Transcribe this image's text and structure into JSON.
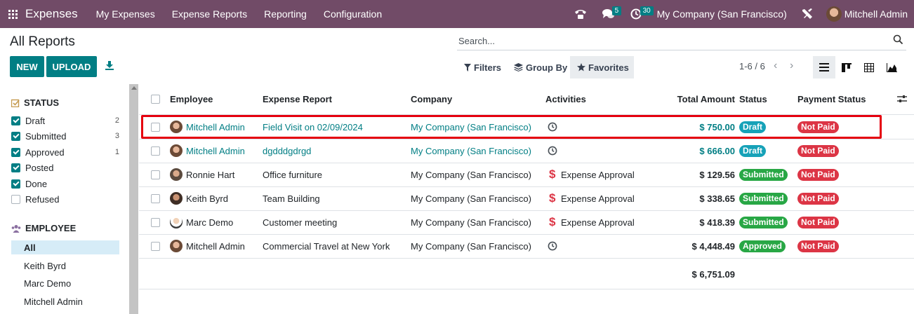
{
  "navbar": {
    "app_name": "Expenses",
    "menu": [
      "My Expenses",
      "Expense Reports",
      "Reporting",
      "Configuration"
    ],
    "messages_count": "5",
    "activities_count": "30",
    "company": "My Company (San Francisco)",
    "user": "Mitchell Admin"
  },
  "control": {
    "title": "All Reports",
    "new_label": "NEW",
    "upload_label": "UPLOAD",
    "search_placeholder": "Search...",
    "filters_label": "Filters",
    "groupby_label": "Group By",
    "favorites_label": "Favorites",
    "pager": "1-6 / 6"
  },
  "sidebar": {
    "status_title": "STATUS",
    "status_items": [
      {
        "label": "Draft",
        "count": "2",
        "checked": true
      },
      {
        "label": "Submitted",
        "count": "3",
        "checked": true
      },
      {
        "label": "Approved",
        "count": "1",
        "checked": true
      },
      {
        "label": "Posted",
        "count": "",
        "checked": true
      },
      {
        "label": "Done",
        "count": "",
        "checked": true
      },
      {
        "label": "Refused",
        "count": "",
        "checked": false
      }
    ],
    "employee_title": "EMPLOYEE",
    "employee_items": [
      "All",
      "Keith Byrd",
      "Marc Demo",
      "Mitchell Admin"
    ]
  },
  "table": {
    "headers": {
      "employee": "Employee",
      "report": "Expense Report",
      "company": "Company",
      "activities": "Activities",
      "amount": "Total Amount",
      "status": "Status",
      "payment": "Payment Status"
    },
    "rows": [
      {
        "employee": "Mitchell Admin",
        "report": "Field Visit on 02/09/2024",
        "company": "My Company (San Francisco)",
        "activity": "",
        "amount": "$ 750.00",
        "status": "Draft",
        "payment": "Not Paid"
      },
      {
        "employee": "Mitchell Admin",
        "report": "dgdddgdrgd",
        "company": "My Company (San Francisco)",
        "activity": "",
        "amount": "$ 666.00",
        "status": "Draft",
        "payment": "Not Paid"
      },
      {
        "employee": "Ronnie Hart",
        "report": "Office furniture",
        "company": "My Company (San Francisco)",
        "activity": "Expense Approval",
        "amount": "$ 129.56",
        "status": "Submitted",
        "payment": "Not Paid"
      },
      {
        "employee": "Keith Byrd",
        "report": "Team Building",
        "company": "My Company (San Francisco)",
        "activity": "Expense Approval",
        "amount": "$ 338.65",
        "status": "Submitted",
        "payment": "Not Paid"
      },
      {
        "employee": "Marc Demo",
        "report": "Customer meeting",
        "company": "My Company (San Francisco)",
        "activity": "Expense Approval",
        "amount": "$ 418.39",
        "status": "Submitted",
        "payment": "Not Paid"
      },
      {
        "employee": "Mitchell Admin",
        "report": "Commercial Travel at New York",
        "company": "My Company (San Francisco)",
        "activity": "",
        "amount": "$ 4,448.49",
        "status": "Approved",
        "payment": "Not Paid"
      }
    ],
    "total": "$ 6,751.09"
  }
}
